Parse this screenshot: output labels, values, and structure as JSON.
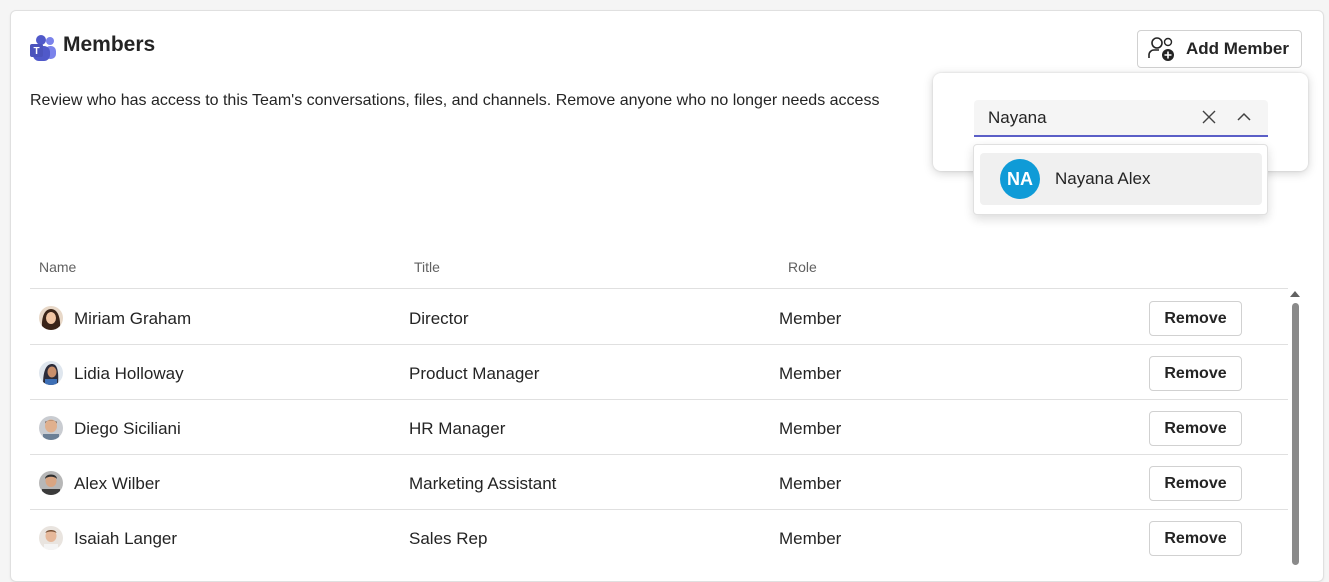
{
  "header": {
    "title": "Members",
    "add_member_label": "Add Member"
  },
  "description": "Review who has access to this Team's conversations, files, and channels. Remove anyone who no longer needs access",
  "table": {
    "columns": [
      "Name",
      "Title",
      "Role"
    ],
    "rows": [
      {
        "name": "Miriam Graham",
        "title": "Director",
        "role": "Member",
        "action": "Remove"
      },
      {
        "name": "Lidia Holloway",
        "title": "Product Manager",
        "role": "Member",
        "action": "Remove"
      },
      {
        "name": "Diego Siciliani",
        "title": "HR Manager",
        "role": "Member",
        "action": "Remove"
      },
      {
        "name": "Alex Wilber",
        "title": "Marketing Assistant",
        "role": "Member",
        "action": "Remove"
      },
      {
        "name": "Isaiah Langer",
        "title": "Sales Rep",
        "role": "Member",
        "action": "Remove"
      }
    ]
  },
  "add_member_popup": {
    "search_value": "Nayana",
    "suggestions": [
      {
        "initials": "NA",
        "name": "Nayana Alex",
        "avatar_color": "#0f9bd7"
      }
    ]
  },
  "colors": {
    "accent": "#5b5fc7",
    "teams_purple": "#5b5fc7"
  }
}
